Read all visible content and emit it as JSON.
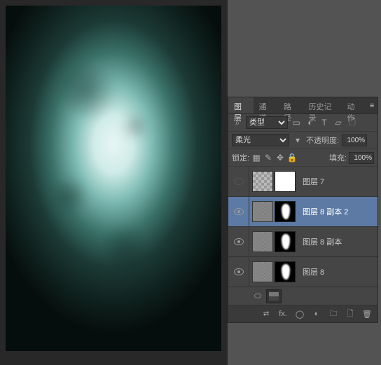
{
  "tabs": {
    "layers": "图层",
    "channels": "通道",
    "paths": "路径",
    "history": "历史记录",
    "actions": "动作"
  },
  "filter": {
    "kind_label": "类型"
  },
  "blend": {
    "mode": "柔光",
    "opacity_label": "不透明度:",
    "opacity_value": "100%"
  },
  "lock": {
    "label": "锁定:",
    "fill_label": "填充:",
    "fill_value": "100%"
  },
  "layers": [
    {
      "visible": false,
      "name": "图层 7",
      "thumbs": [
        "checker",
        "mask-white"
      ],
      "selected": false
    },
    {
      "visible": true,
      "name": "图层 8 副本 2",
      "thumbs": [
        "texture",
        "mask-shape"
      ],
      "selected": true
    },
    {
      "visible": true,
      "name": "图层 8 副本",
      "thumbs": [
        "texture",
        "mask-shape"
      ],
      "selected": false
    },
    {
      "visible": true,
      "name": "图层 8",
      "thumbs": [
        "texture",
        "mask-shape"
      ],
      "selected": false
    }
  ],
  "icons": {
    "magnify": "⌕",
    "image": "▭",
    "adjust": "◐",
    "text": "T",
    "shape": "▱",
    "smart": "🗋",
    "menu": "≡",
    "link": "⮂",
    "fx": "fx.",
    "mask": "◯",
    "fill": "◐",
    "folder": "🗀",
    "new": "🗋",
    "trash": "🗑",
    "lock_transparent": "▦",
    "lock_brush": "✎",
    "lock_move": "✥",
    "lock_all": "🔒",
    "dropdown": "▾",
    "linkchain": "⬭"
  }
}
